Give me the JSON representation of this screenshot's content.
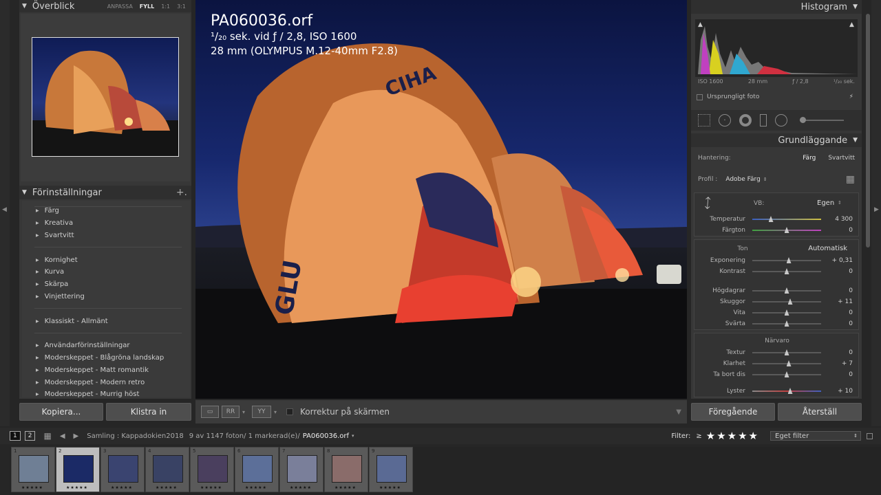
{
  "navigator": {
    "title": "Överblick",
    "options": [
      "ANPASSA",
      "FYLL",
      "1:1",
      "3:1"
    ],
    "selected_option": "FYLL"
  },
  "presets": {
    "title": "Förinställningar",
    "groups": [
      [
        "Färg",
        "Kreativa",
        "Svartvitt"
      ],
      [
        "Kornighet",
        "Kurva",
        "Skärpa",
        "Vinjettering"
      ],
      [
        "Klassiskt - Allmänt"
      ],
      [
        "Användarförinställningar",
        "Moderskeppet - Blågröna landskap",
        "Moderskeppet - Matt romantik",
        "Moderskeppet - Modern retro",
        "Moderskeppet - Murrig höst"
      ]
    ]
  },
  "left_buttons": {
    "copy": "Kopiera...",
    "paste": "Klistra in"
  },
  "image_info": {
    "filename": "PA060036.orf",
    "exposure_line": "¹/₂₀ sek. vid ƒ / 2,8, ISO 1600",
    "lens_line": "28 mm (OLYMPUS M.12-40mm F2.8)"
  },
  "toolbar": {
    "softproof_label": "Korrektur på skärmen"
  },
  "histogram": {
    "title": "Histogram",
    "iso": "ISO 1600",
    "focal": "28 mm",
    "aperture": "ƒ / 2,8",
    "shutter": "¹/₂₀ sek.",
    "original_label": "Ursprungligt foto"
  },
  "basic": {
    "title": "Grundläggande",
    "treatment_label": "Hantering:",
    "treatment_color": "Färg",
    "treatment_bw": "Svartvitt",
    "profile_label": "Profil :",
    "profile_value": "Adobe Färg",
    "wb_label": "VB:",
    "wb_value": "Egen",
    "tone_title": "Ton",
    "auto_label": "Automatisk",
    "presence_title": "Närvaro",
    "wb_sliders": [
      {
        "label": "Temperatur",
        "value": "4 300",
        "pos": 0.27
      },
      {
        "label": "Färgton",
        "value": "0",
        "pos": 0.5
      }
    ],
    "tone_sliders": [
      {
        "label": "Exponering",
        "value": "+ 0,31",
        "pos": 0.53
      },
      {
        "label": "Kontrast",
        "value": "0",
        "pos": 0.5
      },
      {
        "label": "Högdagrar",
        "value": "0",
        "pos": 0.5
      },
      {
        "label": "Skuggor",
        "value": "+ 11",
        "pos": 0.55
      },
      {
        "label": "Vita",
        "value": "0",
        "pos": 0.5
      },
      {
        "label": "Svärta",
        "value": "0",
        "pos": 0.5
      }
    ],
    "presence_sliders": [
      {
        "label": "Textur",
        "value": "0",
        "pos": 0.5
      },
      {
        "label": "Klarhet",
        "value": "+ 7",
        "pos": 0.53
      },
      {
        "label": "Ta bort dis",
        "value": "0",
        "pos": 0.5
      },
      {
        "label": "Lyster",
        "value": "+ 10",
        "pos": 0.55
      }
    ]
  },
  "right_buttons": {
    "previous": "Föregående",
    "reset": "Återställ"
  },
  "filmstrip_bar": {
    "page1": "1",
    "page2": "2",
    "source": "Samling : Kappadokien2018",
    "count": "9 av 1147 foton/ 1 markerad(e)/",
    "current": "PA060036.orf",
    "filter_label": "Filter:",
    "filter_op": "≥",
    "stars": "★★★★★",
    "filter_select": "Eget filter"
  },
  "filmstrip": {
    "cells": [
      {
        "num": "1",
        "bg": "#6f7f95"
      },
      {
        "num": "2",
        "bg": "#1b2a66"
      },
      {
        "num": "3",
        "bg": "#3a4470"
      },
      {
        "num": "4",
        "bg": "#394264"
      },
      {
        "num": "5",
        "bg": "#4a3f5e"
      },
      {
        "num": "6",
        "bg": "#5c6f99"
      },
      {
        "num": "7",
        "bg": "#7a7f9a"
      },
      {
        "num": "8",
        "bg": "#8a6c6a"
      },
      {
        "num": "9",
        "bg": "#5a6a94"
      }
    ],
    "selected": 1
  }
}
